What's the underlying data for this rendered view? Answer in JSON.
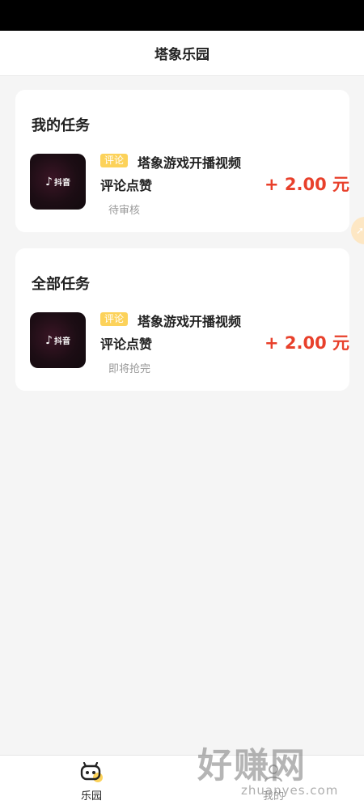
{
  "header": {
    "title": "塔象乐园"
  },
  "my_tasks": {
    "heading": "我的任务",
    "item": {
      "thumb_app": "抖音",
      "tag": "评论",
      "title": "塔象游戏开播视频",
      "subtitle": "评论点赞",
      "reward": "+ 2.00 元",
      "status": "待审核"
    }
  },
  "all_tasks": {
    "heading": "全部任务",
    "item": {
      "thumb_app": "抖音",
      "tag": "评论",
      "title": "塔象游戏开播视频",
      "subtitle": "评论点赞",
      "reward": "+ 2.00 元",
      "status": "即将抢完"
    }
  },
  "tab_bar": {
    "home_label": "乐园",
    "mine_label": "我的"
  },
  "watermark": {
    "main": "好赚网",
    "sub": "zhuanyes.com"
  },
  "colors": {
    "accent_red": "#e8402b",
    "tag_yellow": "#fcd25a",
    "background": "#f5f5f5"
  }
}
